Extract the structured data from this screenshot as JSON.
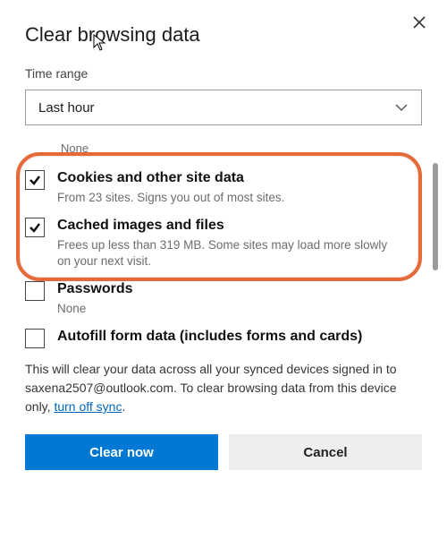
{
  "dialog": {
    "title": "Clear browsing data",
    "time_range_label": "Time range",
    "time_range_value": "Last hour",
    "truncated_top": "None",
    "items": [
      {
        "checked": true,
        "title": "Cookies and other site data",
        "subtitle": "From 23 sites. Signs you out of most sites."
      },
      {
        "checked": true,
        "title": "Cached images and files",
        "subtitle": "Frees up less than 319 MB. Some sites may load more slowly on your next visit."
      },
      {
        "checked": false,
        "title": "Passwords",
        "subtitle": "None"
      },
      {
        "checked": false,
        "title": "Autofill form data (includes forms and cards)",
        "subtitle": ""
      }
    ],
    "footer_a": "This will clear your data across all your synced devices signed in to saxena2507@outlook.com. To clear browsing data from this device only, ",
    "footer_link": "turn off sync",
    "footer_b": ".",
    "primary_btn": "Clear now",
    "secondary_btn": "Cancel"
  }
}
